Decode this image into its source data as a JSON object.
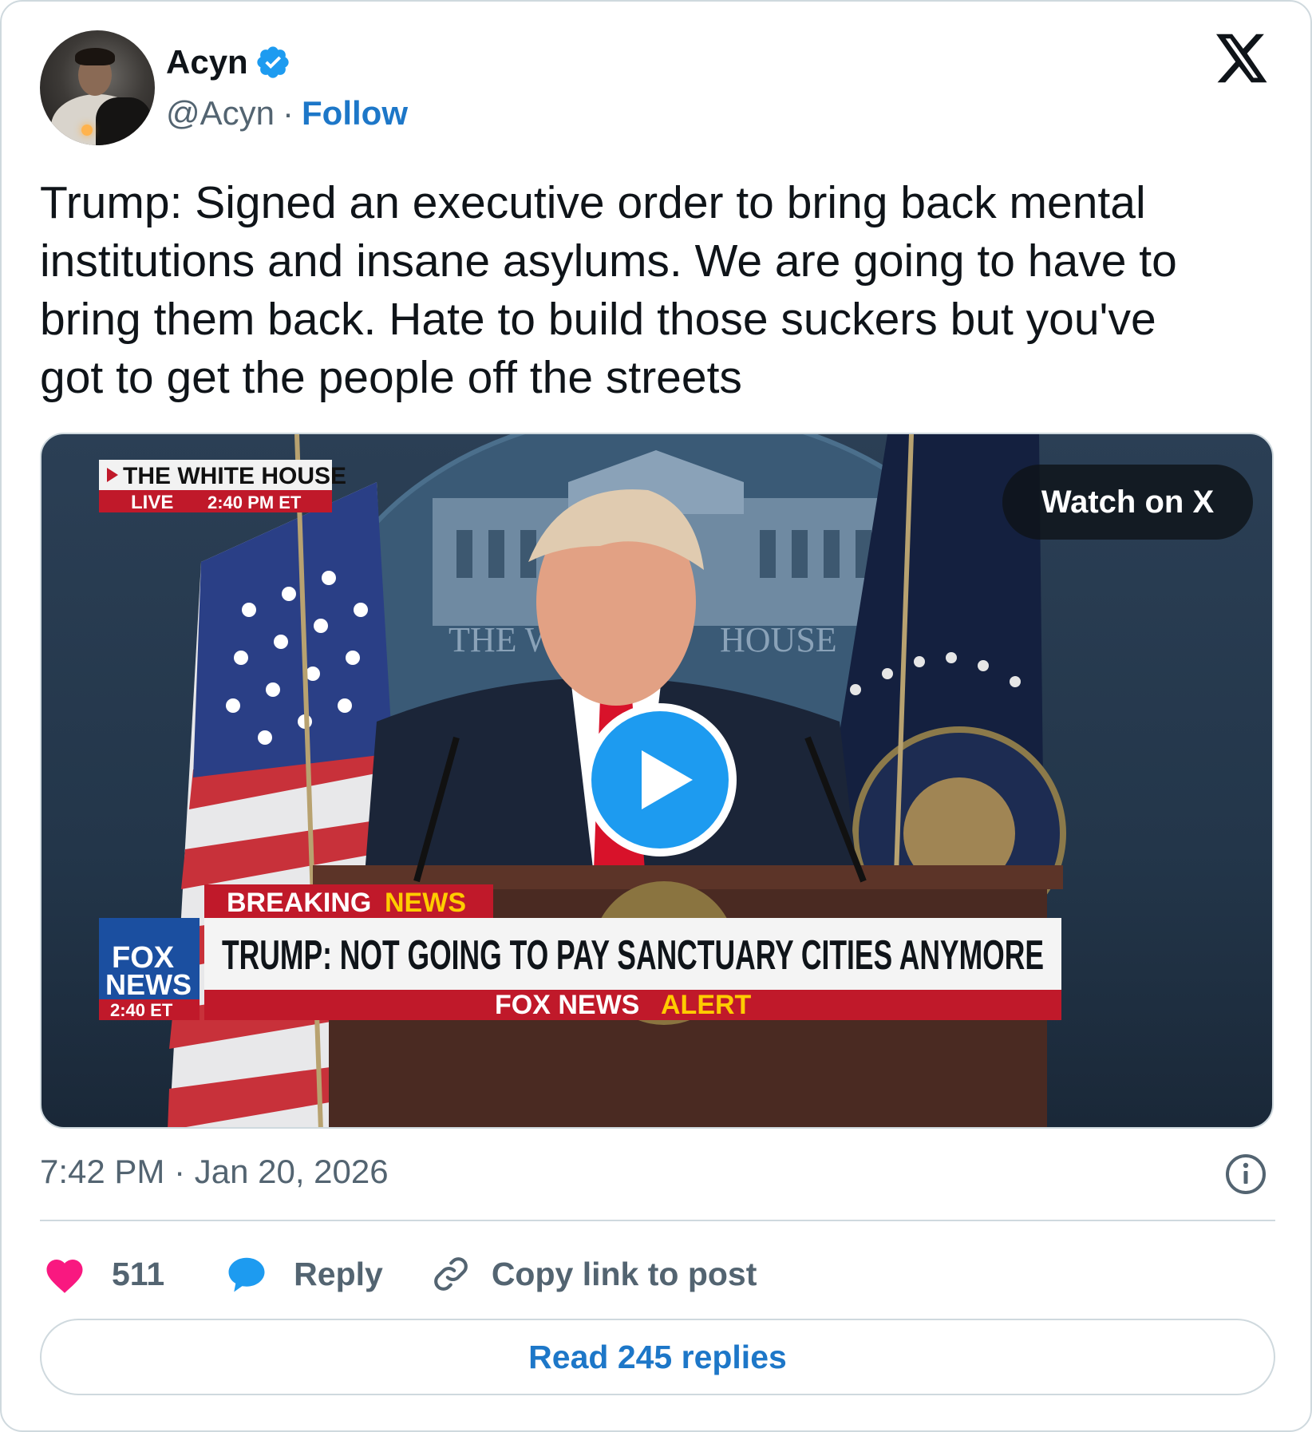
{
  "author": {
    "name": "Acyn",
    "handle": "@Acyn",
    "separator": "·",
    "follow_label": "Follow",
    "verified": true
  },
  "tweet": {
    "text": "Trump: Signed an executive order to bring back mental\ninstitutions and insane asylums. We are going to have to\nbring them back. Hate to build those suckers but you've\ngot to get the people off the streets"
  },
  "media": {
    "watch_label": "Watch on X",
    "overlay": {
      "location_label": "THE WHITE HOUSE",
      "live_label": "LIVE",
      "live_time": "2:40 PM ET",
      "breaking": "BREAKING",
      "news": "NEWS",
      "headline": "TRUMP: NOT GOING TO PAY SANCTUARY CITIES ANYMORE",
      "alert_brand": "FOX NEWS",
      "alert_word": "ALERT",
      "logo_top": "FOX",
      "logo_bottom": "NEWS",
      "logo_time": "2:40 ET",
      "backdrop_left": "THE W",
      "backdrop_right": "HOUSE"
    }
  },
  "meta": {
    "timestamp": "7:42 PM · Jan 20, 2026"
  },
  "actions": {
    "likes": "511",
    "reply_label": "Reply",
    "copy_label": "Copy link to post"
  },
  "read_replies_label": "Read 245 replies",
  "colors": {
    "accent": "#1d77c8",
    "heart": "#f91880",
    "reply_bubble": "#1d9bf0",
    "muted": "#536471",
    "border": "#cfd9de"
  }
}
